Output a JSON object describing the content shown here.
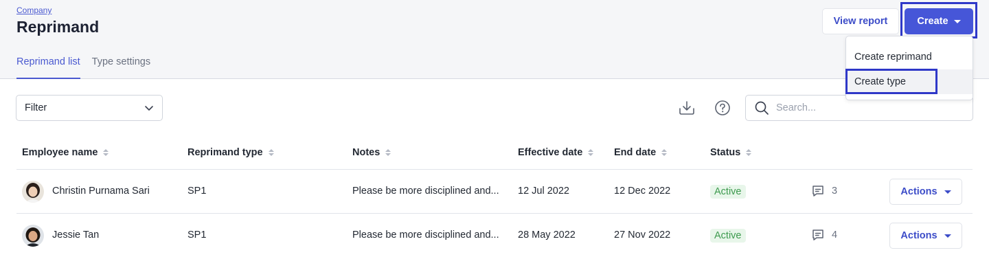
{
  "header": {
    "breadcrumb": "Company",
    "title": "Reprimand",
    "tabs": [
      {
        "label": "Reprimand list",
        "active": true
      },
      {
        "label": "Type settings",
        "active": false
      }
    ],
    "view_report_label": "View report",
    "create_label": "Create"
  },
  "create_menu": {
    "items": [
      {
        "label": "Create reprimand"
      },
      {
        "label": "Create type"
      }
    ]
  },
  "toolbar": {
    "filter_label": "Filter",
    "search_placeholder": "Search...",
    "icons": [
      "download-icon",
      "help-icon",
      "search-icon"
    ]
  },
  "table": {
    "columns": [
      {
        "label": "Employee name"
      },
      {
        "label": "Reprimand type"
      },
      {
        "label": "Notes"
      },
      {
        "label": "Effective date"
      },
      {
        "label": "End date"
      },
      {
        "label": "Status"
      }
    ],
    "rows": [
      {
        "employee": "Christin Purnama Sari",
        "type": "SP1",
        "notes": "Please be more disciplined and...",
        "effective_date": "12 Jul 2022",
        "end_date": "12 Dec 2022",
        "status": "Active",
        "comments": "3",
        "actions_label": "Actions"
      },
      {
        "employee": "Jessie Tan",
        "type": "SP1",
        "notes": "Please be more disciplined and...",
        "effective_date": "28 May 2022",
        "end_date": "27 Nov 2022",
        "status": "Active",
        "comments": "4",
        "actions_label": "Actions"
      }
    ]
  },
  "colors": {
    "accent": "#4656d8",
    "highlight": "#2f38c8",
    "status_active_bg": "#e8f6ea",
    "status_active_text": "#3d9a4e"
  }
}
